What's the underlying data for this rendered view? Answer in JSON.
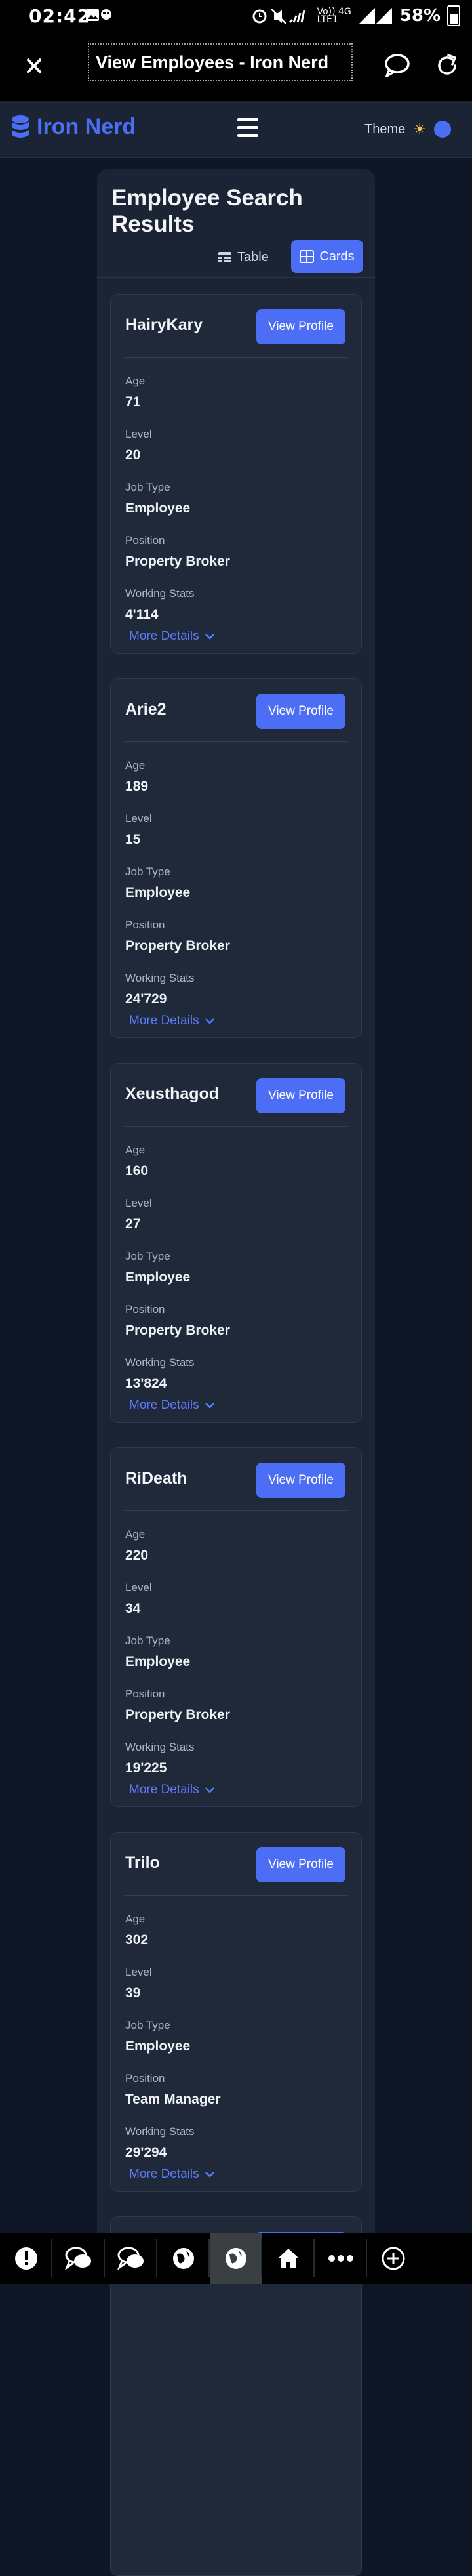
{
  "status_bar": {
    "time": "02:42",
    "battery": "58%",
    "network_top": "Vo)) 4G",
    "network_bottom": "LTE1"
  },
  "top_bar": {
    "title": "View Employees - Iron Nerd"
  },
  "nav": {
    "brand": "Iron Nerd",
    "theme_label": "Theme"
  },
  "page": {
    "title": "Employee Search Results",
    "view_table_label": "Table",
    "view_cards_label": "Cards"
  },
  "labels": {
    "age": "Age",
    "level": "Level",
    "job_type": "Job Type",
    "position": "Position",
    "working_stats": "Working Stats",
    "view_profile": "View Profile",
    "more_details": "More Details"
  },
  "employees": [
    {
      "name": "HairyKary",
      "age": "71",
      "level": "20",
      "job_type": "Employee",
      "position": "Property Broker",
      "working_stats": "4'114"
    },
    {
      "name": "Arie2",
      "age": "189",
      "level": "15",
      "job_type": "Employee",
      "position": "Property Broker",
      "working_stats": "24'729"
    },
    {
      "name": "Xeusthagod",
      "age": "160",
      "level": "27",
      "job_type": "Employee",
      "position": "Property Broker",
      "working_stats": "13'824"
    },
    {
      "name": "RiDeath",
      "age": "220",
      "level": "34",
      "job_type": "Employee",
      "position": "Property Broker",
      "working_stats": "19'225"
    },
    {
      "name": "Trilo",
      "age": "302",
      "level": "39",
      "job_type": "Employee",
      "position": "Team Manager",
      "working_stats": "29'294"
    }
  ],
  "colors": {
    "accent": "#4c6ef5",
    "background": "#0f1726",
    "panel": "#1b2434",
    "card": "#1f293a"
  },
  "icons": {
    "close": "close-icon",
    "chat": "chat-icon",
    "reload": "reload-icon",
    "brand": "database-icon",
    "menu": "hamburger-menu-icon",
    "theme": "sun-icon",
    "table": "table-icon",
    "cards": "cards-grid-icon",
    "more": "chevron-down-icon"
  },
  "bottom_bar": [
    "alert-icon",
    "chat-icon",
    "chat-icon",
    "globe-icon",
    "globe-icon",
    "home-icon",
    "more-icon",
    "add-icon"
  ]
}
